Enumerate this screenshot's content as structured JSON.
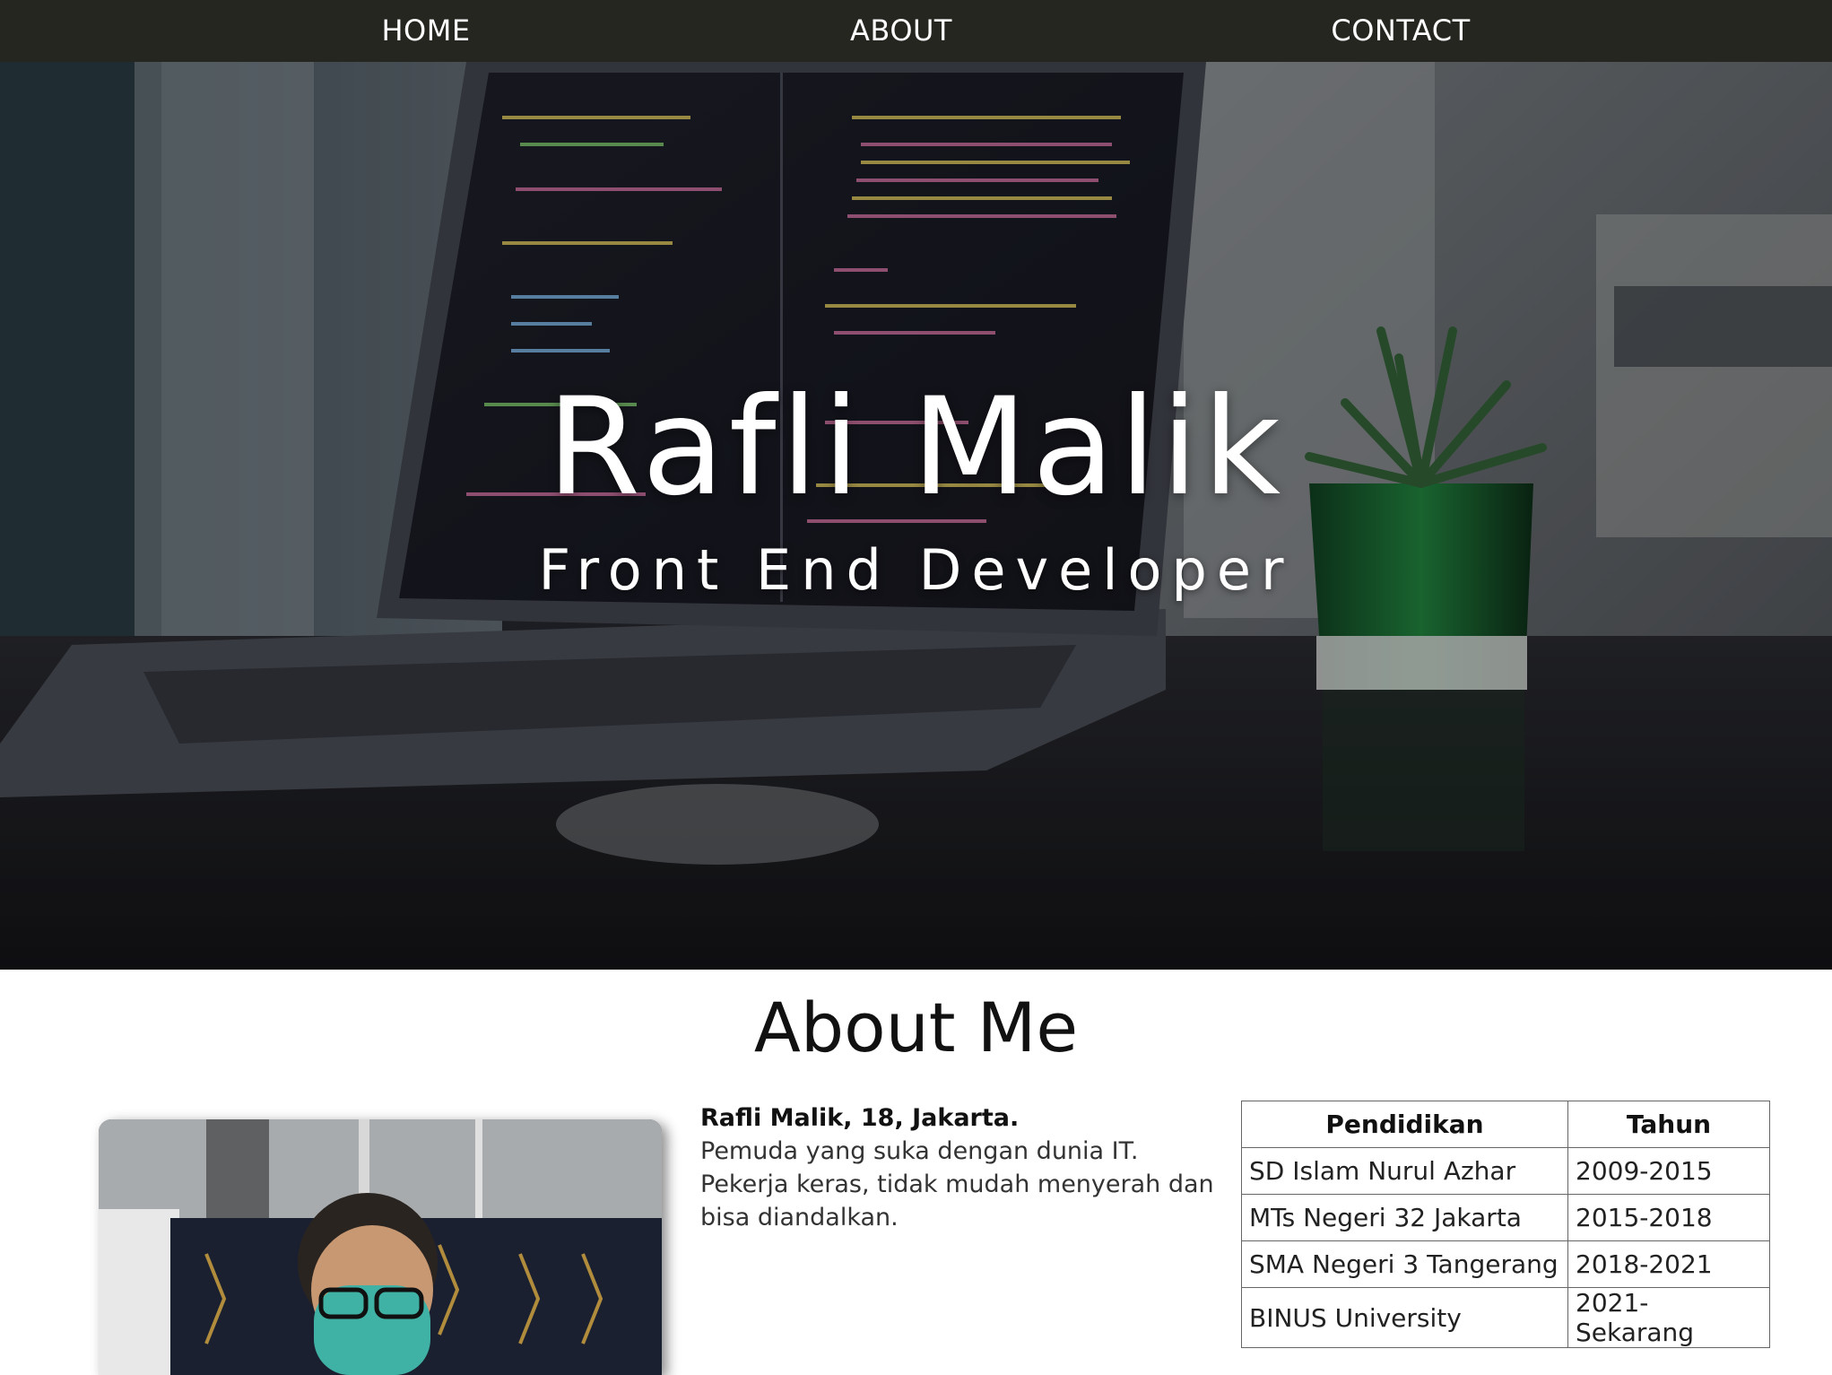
{
  "nav": {
    "home_label": "HOME",
    "about_label": "ABOUT",
    "contact_label": "CONTACT"
  },
  "hero": {
    "name": "Rafli Malik",
    "role": "Front End Developer"
  },
  "about": {
    "heading": "About Me",
    "bio_head": "Rafli Malik, 18, Jakarta.",
    "bio_text": "Pemuda yang suka dengan dunia IT. Pekerja keras, tidak mudah menyerah dan bisa diandalkan.",
    "table": {
      "headers": [
        "Pendidikan",
        "Tahun"
      ],
      "rows": [
        [
          "SD Islam Nurul Azhar",
          "2009-2015"
        ],
        [
          "MTs Negeri 32 Jakarta",
          "2015-2018"
        ],
        [
          "SMA Negeri 3 Tangerang",
          "2018-2021"
        ],
        [
          "BINUS University",
          "2021-Sekarang"
        ]
      ]
    }
  },
  "colors": {
    "navbar_bg": "#262621",
    "nav_text": "#ffffff",
    "page_bg": "#ffffff"
  }
}
